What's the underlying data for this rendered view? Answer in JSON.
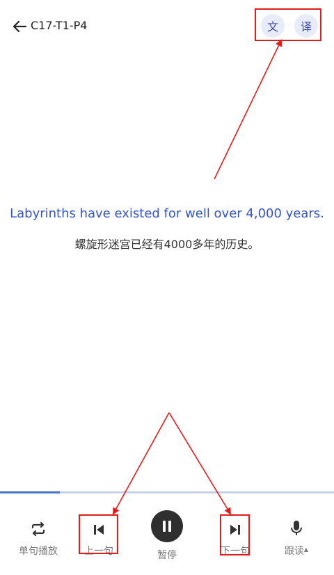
{
  "header": {
    "title": "C17-T1-P4",
    "btn_wen": "文",
    "btn_yi": "译"
  },
  "content": {
    "english": "Labyrinths have existed for well over 4,000 years.",
    "chinese": "螺旋形迷宫已经有4000多年的历史。"
  },
  "progress": {
    "fraction": 0.18
  },
  "controls": {
    "single": "单句播放",
    "prev": "上一句",
    "pause": "暂停",
    "next": "下一句",
    "read": "跟读"
  },
  "colors": {
    "accent": "#3454c9",
    "annotation": "#e21b1b",
    "progress": "#4a73d6"
  }
}
